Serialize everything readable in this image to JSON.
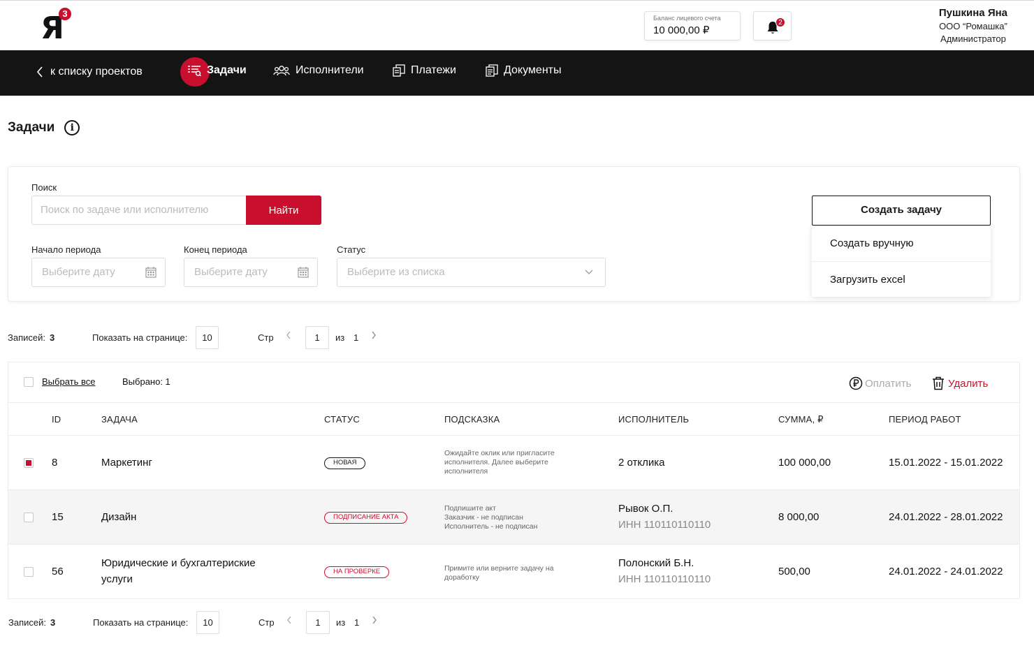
{
  "header": {
    "logo_text": "Я",
    "logo_sup": "3",
    "balance_label": "Баланс лицевого счета",
    "balance_value": "10 000,00 ₽",
    "notifications_count": "2",
    "user_name": "Пушкина Яна",
    "user_org": "ООО “Ромашка”",
    "user_role": "Администратор"
  },
  "nav": {
    "back_label": "к списку проектов",
    "items": [
      {
        "label": "Задачи",
        "icon": "tasks-icon",
        "active": true
      },
      {
        "label": "Исполнители",
        "icon": "people-icon",
        "active": false
      },
      {
        "label": "Платежи",
        "icon": "payments-icon",
        "active": false
      },
      {
        "label": "Документы",
        "icon": "documents-icon",
        "active": false
      }
    ]
  },
  "page": {
    "title": "Задачи",
    "info_glyph": "i"
  },
  "filters": {
    "search_label": "Поиск",
    "search_placeholder": "Поиск по задаче или исполнителю",
    "search_button": "Найти",
    "start_label": "Начало периода",
    "start_placeholder": "Выберите дату",
    "end_label": "Конец периода",
    "end_placeholder": "Выберите дату",
    "status_label": "Статус",
    "status_placeholder": "Выберите из списка",
    "create_button": "Создать задачу",
    "create_options": [
      "Создать вручную",
      "Загрузить excel"
    ]
  },
  "pagination": {
    "records_label": "Записей:",
    "records_count": "3",
    "per_page_label": "Показать на странице:",
    "per_page_value": "10",
    "page_label": "Стр",
    "current_page": "1",
    "of_label": "из",
    "total_pages": "1"
  },
  "toolbar": {
    "select_all": "Выбрать все",
    "selected_text": "Выбрано: 1",
    "pay_label": "Оплатить",
    "delete_label": "Удалить"
  },
  "table": {
    "columns": [
      "ID",
      "ЗАДАЧА",
      "СТАТУС",
      "ПОДСКАЗКА",
      "ИСПОЛНИТЕЛЬ",
      "СУММА, ₽",
      "ПЕРИОД РАБОТ"
    ],
    "rows": [
      {
        "checked": true,
        "id": "8",
        "task_line1": "Маркетинг",
        "task_line2": "",
        "status": "НОВАЯ",
        "hint": [
          "Ожидайте оклик или пригласите",
          "исполнителя. Далее выберите",
          "исполнителя"
        ],
        "executor": "2 отклика",
        "executor_inn": "",
        "amount": "100 000,00",
        "period": "15.01.2022 - 15.01.2022"
      },
      {
        "checked": false,
        "id": "15",
        "task_line1": "Дизайн",
        "task_line2": "",
        "status": "ПОДПИСАНИЕ АКТА",
        "hint": [
          "Подпишите акт",
          "Заказчик - не подписан",
          "Исполнитель - не подписан"
        ],
        "executor": "Рывок О.П.",
        "executor_inn": "ИНН 110110110110",
        "amount": "8 000,00",
        "period": "24.01.2022 - 28.01.2022"
      },
      {
        "checked": false,
        "id": "56",
        "task_line1": "Юридические и бухгалтериские",
        "task_line2": "услуги",
        "status": "НА ПРОВЕРКЕ",
        "hint": [
          "Примите или верните задачу на",
          "доработку"
        ],
        "executor": "Полонский Б.Н.",
        "executor_inn": "ИНН 110110110110",
        "amount": "500,00",
        "period": "24.01.2022 - 24.01.2022"
      }
    ]
  },
  "colors": {
    "accent": "#c8102e",
    "nav_bg": "#141414"
  }
}
